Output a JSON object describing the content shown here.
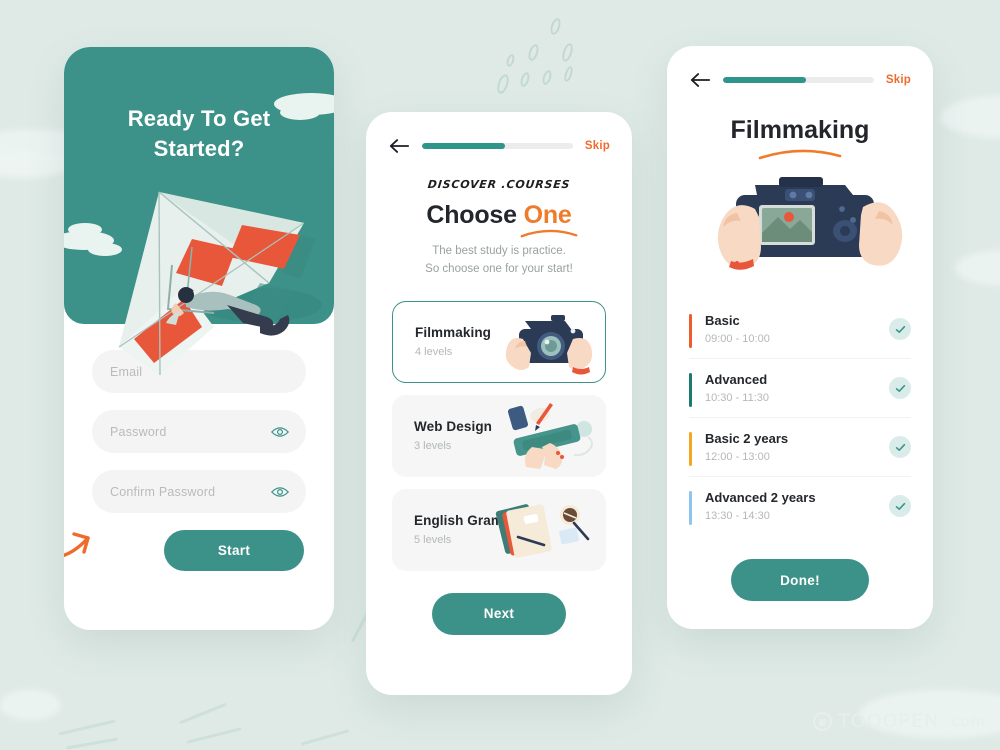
{
  "theme": {
    "page_bg": "#dfeae6",
    "brand_teal": "#3c9289",
    "accent_orange": "#ef7c2c",
    "skip_orange": "#ef6b2c",
    "muted_text": "#b4b8b9"
  },
  "watermark": {
    "text": "TOOOPEN",
    "suffix": ".com",
    "logo_icon": "tooopen-logo-icon"
  },
  "screen1": {
    "hero_title_line1": "Ready To Get",
    "hero_title_line2": "Started?",
    "illustration": "hang-glider-illustration",
    "fields": [
      {
        "name": "email-field",
        "placeholder": "Email",
        "value": "",
        "has_eye": false
      },
      {
        "name": "password-field",
        "placeholder": "Password",
        "value": "",
        "has_eye": true
      },
      {
        "name": "confirm-password-field",
        "placeholder": "Confirm Password",
        "value": "",
        "has_eye": true
      }
    ],
    "eye_icon": "eye-icon",
    "arrow_doodle": "curly-arrow-icon",
    "start_label": "Start"
  },
  "screen2": {
    "back_icon": "back-arrow-icon",
    "progress_percent": 55,
    "skip_label": "Skip",
    "kicker": "DISCOVER .COURSES",
    "headline_plain": "Choose ",
    "headline_accent": "One",
    "subhead_line1": "The best study is practice.",
    "subhead_line2": "So choose one for your start!",
    "courses": [
      {
        "title": "Filmmaking",
        "levels": "4 levels",
        "selected": true,
        "art": "camera-hands-icon"
      },
      {
        "title": "Web Design",
        "levels": "3 levels",
        "selected": false,
        "art": "desk-keyboard-icon"
      },
      {
        "title": "English Grammar",
        "levels": "5 levels",
        "selected": false,
        "art": "books-coffee-icon"
      }
    ],
    "next_label": "Next"
  },
  "screen3": {
    "back_icon": "back-arrow-icon",
    "progress_percent": 55,
    "skip_label": "Skip",
    "title": "Filmmaking",
    "illustration": "camera-back-hands-illustration",
    "schedule": [
      {
        "name": "Basic",
        "time": "09:00 - 10:00",
        "bar_color": "#ee5b2d",
        "checked": true
      },
      {
        "name": "Advanced",
        "time": "10:30 - 11:30",
        "bar_color": "#1d7a6e",
        "checked": true
      },
      {
        "name": "Basic 2 years",
        "time": "12:00 - 13:00",
        "bar_color": "#f5a623",
        "checked": true
      },
      {
        "name": "Advanced 2 years",
        "time": "13:30 - 14:30",
        "bar_color": "#8ec5f0",
        "checked": true
      }
    ],
    "check_icon": "check-circle-icon",
    "done_label": "Done!"
  }
}
